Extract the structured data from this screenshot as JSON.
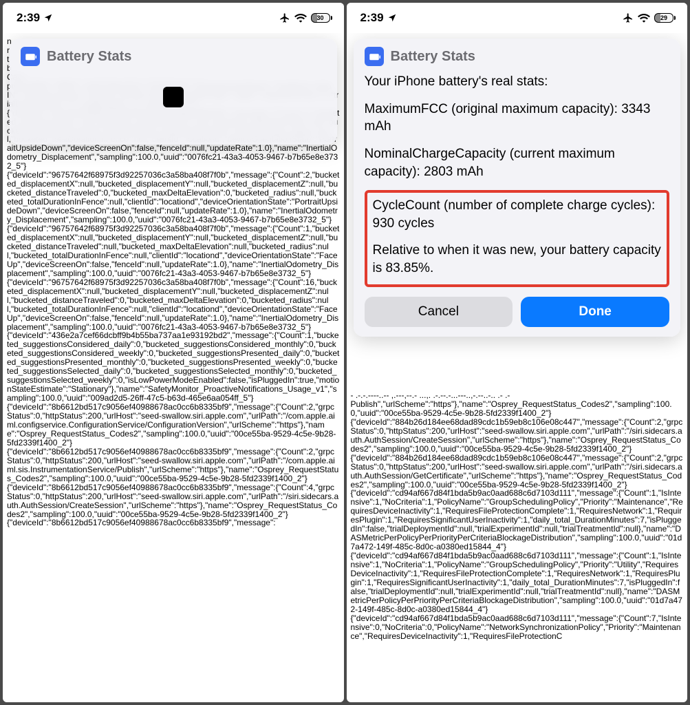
{
  "statusBar": {
    "time": "2:39",
    "batteryLeft": "30",
    "batteryRight": "29"
  },
  "leftScreen": {
    "dialog": {
      "title": "Battery Stats"
    },
    "bgText": "n\nr\nt\nb\nCarri..._.._.... ._._.. ... ..- --,·--... -----..,.·-,..---..-.- ...- .-.-,\nproductSku\":\"HN/A\",\"rolloverReason\":\"scheduled\",\"servingCarrierName\":\"Vodafone India\nIN\",\"startTimestamp\":\"2024-01-05T00:15:00Z\",\"stateDbType\":\"sqlite\",\"stateDbVersion\":3,\"trialExperiments\":\"2\",\"trialRollouts\":\"2\",\"version\":\"2.4\"}\n{\"deviceId\":\"96757642f68975f3d92257036c3a58ba408f7f0b\",\"message\":{\"Count\":1,\"bucketed_displacementX\":null,\"bucketed_displacementY\":null,\"bucketed_displacementZ\":null,\"bucketed_distanceTraveled\":null,\"bucketed_maxDeltaElevation\":null,\"bucketed_radius\":null,\"bucketed_totalDurationInFence\":null,\"clientId\":\"locationd\",\"deviceOrientationState\":\"PortraitUpsideDown\",\"deviceScreenOn\":false,\"fenceId\":null,\"updateRate\":1.0},\"name\":\"InertialOdometry_Displacement\",\"sampling\":100.0,\"uuid\":\"0076fc21-43a3-4053-9467-b7b65e8e3732_5\"}\n{\"deviceId\":\"96757642f68975f3d92257036c3a58ba408f7f0b\",\"message\":{\"Count\":2,\"bucketed_displacementX\":null,\"bucketed_displacementY\":null,\"bucketed_displacementZ\":null,\"bucketed_distanceTraveled\":0,\"bucketed_maxDeltaElevation\":0,\"bucketed_radius\":null,\"bucketed_totalDurationInFence\":null,\"clientId\":\"locationd\",\"deviceOrientationState\":\"PortraitUpsideDown\",\"deviceScreenOn\":false,\"fenceId\":null,\"updateRate\":1.0},\"name\":\"InertialOdometry_Displacement\",\"sampling\":100.0,\"uuid\":\"0076fc21-43a3-4053-9467-b7b65e8e3732_5\"}\n{\"deviceId\":\"96757642f68975f3d92257036c3a58ba408f7f0b\",\"message\":{\"Count\":1,\"bucketed_displacementX\":null,\"bucketed_displacementY\":null,\"bucketed_displacementZ\":null,\"bucketed_distanceTraveled\":null,\"bucketed_maxDeltaElevation\":null,\"bucketed_radius\":null,\"bucketed_totalDurationInFence\":null,\"clientId\":\"locationd\",\"deviceOrientationState\":\"FaceUp\",\"deviceScreenOn\":false,\"fenceId\":null,\"updateRate\":1.0},\"name\":\"InertialOdometry_Displacement\",\"sampling\":100.0,\"uuid\":\"0076fc21-43a3-4053-9467-b7b65e8e3732_5\"}\n{\"deviceId\":\"96757642f68975f3d92257036c3a58ba408f7f0b\",\"message\":{\"Count\":16,\"bucketed_displacementX\":null,\"bucketed_displacementY\":null,\"bucketed_displacementZ\":null,\"bucketed_distanceTraveled\":0,\"bucketed_maxDeltaElevation\":0,\"bucketed_radius\":null,\"bucketed_totalDurationInFence\":null,\"clientId\":\"locationd\",\"deviceOrientationState\":\"FaceUp\",\"deviceScreenOn\":false,\"fenceId\":null,\"updateRate\":1.0},\"name\":\"InertialOdometry_Displacement\",\"sampling\":100.0,\"uuid\":\"0076fc21-43a3-4053-9467-b7b65e8e3732_5\"}\n{\"deviceId\":\"436e2a7cef66dcbff9b4b55ba737aa1e93192bd2\",\"message\":{\"Count\":1,\"bucketed_suggestionsConsidered_daily\":0,\"bucketed_suggestionsConsidered_monthly\":0,\"bucketed_suggestionsConsidered_weekly\":0,\"bucketed_suggestionsPresented_daily\":0,\"bucketed_suggestionsPresented_monthly\":0,\"bucketed_suggestionsPresented_weekly\":0,\"bucketed_suggestionsSelected_daily\":0,\"bucketed_suggestionsSelected_monthly\":0,\"bucketed_suggestionsSelected_weekly\":0,\"isLowPowerModeEnabled\":false,\"isPluggedIn\":true,\"motionStateEstimate\":\"Stationary\"},\"name\":\"SafetyMonitor_ProactiveNotifications_Usage_v1\",\"sampling\":100.0,\"uuid\":\"009ad2d5-26ff-47c5-b63d-465e6aa054ff_5\"}\n{\"deviceId\":\"8b6612bd517c9056ef40988678ac0cc6b8335bf9\",\"message\":{\"Count\":2,\"grpcStatus\":0,\"httpStatus\":200,\"urlHost\":\"seed-swallow.siri.apple.com\",\"urlPath\":\"/com.apple.aiml.configservice.ConfigurationService/ConfigurationVersion\",\"urlScheme\":\"https\"},\"name\":\"Osprey_RequestStatus_Codes2\",\"sampling\":100.0,\"uuid\":\"00ce55ba-9529-4c5e-9b28-5fd2339f1400_2\"}\n{\"deviceId\":\"8b6612bd517c9056ef40988678ac0cc6b8335bf9\",\"message\":{\"Count\":2,\"grpcStatus\":0,\"httpStatus\":200,\"urlHost\":\"seed-swallow.siri.apple.com\",\"urlPath\":\"/com.apple.aiml.sis.InstrumentationService/Publish\",\"urlScheme\":\"https\"},\"name\":\"Osprey_RequestStatus_Codes2\",\"sampling\":100.0,\"uuid\":\"00ce55ba-9529-4c5e-9b28-5fd2339f1400_2\"}\n{\"deviceId\":\"8b6612bd517c9056ef40988678ac0cc6b8335bf9\",\"message\":{\"Count\":4,\"grpcStatus\":0,\"httpStatus\":200,\"urlHost\":\"seed-swallow.siri.apple.com\",\"urlPath\":\"/siri.sidecars.auth.AuthSession/CreateSession\",\"urlScheme\":\"https\"},\"name\":\"Osprey_RequestStatus_Codes2\",\"sampling\":100.0,\"uuid\":\"00ce55ba-9529-4c5e-9b28-5fd2339f1400_2\"}\n{\"deviceId\":\"8b6612bd517c9056ef40988678ac0cc6b8335bf9\",\"message\":"
  },
  "rightScreen": {
    "dialog": {
      "title": "Battery Stats",
      "heading": "Your iPhone battery's real stats:",
      "maxFcc": "MaximumFCC (original maximum capacity): 3343 mAh",
      "nominal": "NominalChargeCapacity (current maximum capacity): 2803 mAh",
      "cycles": "CycleCount (number of complete charge cycles): 930 cycles",
      "relative": "Relative to when it was new, your battery capacity is 83.85%.",
      "cancel": "Cancel",
      "done": "Done"
    },
    "bgText": "- .-.-.----..-- ,.---,--.- ...,. .-.--.-...---..,-.--..-.. .- .-\nPublish\",\"urlScheme\":\"https\"},\"name\":\"Osprey_RequestStatus_Codes2\",\"sampling\":100.0,\"uuid\":\"00ce55ba-9529-4c5e-9b28-5fd2339f1400_2\"}\n{\"deviceId\":\"884b26d184ee68dad89cdc1b59eb8c106e08c447\",\"message\":{\"Count\":2,\"grpcStatus\":0,\"httpStatus\":200,\"urlHost\":\"seed-swallow.siri.apple.com\",\"urlPath\":\"/siri.sidecars.auth.AuthSession/CreateSession\",\"urlScheme\":\"https\"},\"name\":\"Osprey_RequestStatus_Codes2\",\"sampling\":100.0,\"uuid\":\"00ce55ba-9529-4c5e-9b28-5fd2339f1400_2\"}\n{\"deviceId\":\"884b26d184ee68dad89cdc1b59eb8c106e08c447\",\"message\":{\"Count\":2,\"grpcStatus\":0,\"httpStatus\":200,\"urlHost\":\"seed-swallow.siri.apple.com\",\"urlPath\":\"/siri.sidecars.auth.AuthSession/GetCertificate\",\"urlScheme\":\"https\"},\"name\":\"Osprey_RequestStatus_Codes2\",\"sampling\":100.0,\"uuid\":\"00ce55ba-9529-4c5e-9b28-5fd2339f1400_2\"}\n{\"deviceId\":\"cd94af667d84f1bda5b9ac0aad688c6d7103d111\",\"message\":{\"Count\":1,\"IsIntensive\":1,\"NoCriteria\":1,\"PolicyName\":\"GroupSchedulingPolicy\",\"Priority\":\"Maintenance\",\"RequiresDeviceInactivity\":1,\"RequiresFileProtectionComplete\":1,\"RequiresNetwork\":1,\"RequiresPlugin\":1,\"RequiresSignificantUserInactivity\":1,\"daily_total_DurationMinutes\":7,\"isPluggedIn\":false,\"trialDeploymentId\":null,\"trialExperimentId\":null,\"trialTreatmentId\":null},\"name\":\"DASMetricPerPolicyPerPriorityPerCriteriaBlockageDistribution\",\"sampling\":100.0,\"uuid\":\"01d7a472-149f-485c-8d0c-a0380ed15844_4\"}\n{\"deviceId\":\"cd94af667d84f1bda5b9ac0aad688c6d7103d111\",\"message\":{\"Count\":1,\"IsIntensive\":1,\"NoCriteria\":1,\"PolicyName\":\"GroupSchedulingPolicy\",\"Priority\":\"Utility\",\"RequiresDeviceInactivity\":1,\"RequiresFileProtectionComplete\":1,\"RequiresNetwork\":1,\"RequiresPlugin\":1,\"RequiresSignificantUserInactivity\":1,\"daily_total_DurationMinutes\":7,\"isPluggedIn\":false,\"trialDeploymentId\":null,\"trialExperimentId\":null,\"trialTreatmentId\":null},\"name\":\"DASMetricPerPolicyPerPriorityPerCriteriaBlockageDistribution\",\"sampling\":100.0,\"uuid\":\"01d7a472-149f-485c-8d0c-a0380ed15844_4\"}\n{\"deviceId\":\"cd94af667d84f1bda5b9ac0aad688c6d7103d111\",\"message\":{\"Count\":7,\"IsIntensive\":0,\"NoCriteria\":0,\"PolicyName\":\"NetworkSynchronizationPolicy\",\"Priority\":\"Maintenance\",\"RequiresDeviceInactivity\":1,\"RequiresFileProtectionC"
  }
}
